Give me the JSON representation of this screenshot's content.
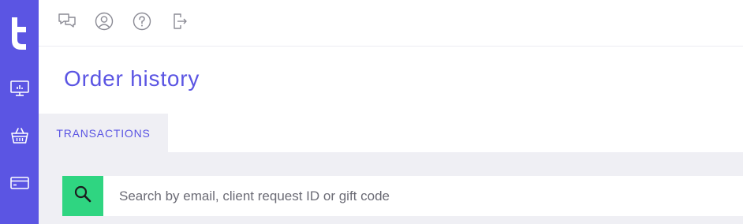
{
  "sidebar": {
    "background": "#5b55e3",
    "logo": "brand-logo",
    "items": [
      {
        "icon": "monitor-chart-icon"
      },
      {
        "icon": "basket-icon"
      },
      {
        "icon": "card-icon"
      }
    ]
  },
  "topbar": {
    "icons": [
      "chat-bubbles-icon",
      "user-icon",
      "help-icon",
      "logout-icon"
    ]
  },
  "page": {
    "title": "Order history",
    "accent": "#5b55e3"
  },
  "tabs": [
    {
      "label": "TRANSACTIONS",
      "active": true
    }
  ],
  "search": {
    "placeholder": "Search by email, client request ID or gift code",
    "value": "",
    "button_color": "#2fd581",
    "icon": "search-icon"
  }
}
